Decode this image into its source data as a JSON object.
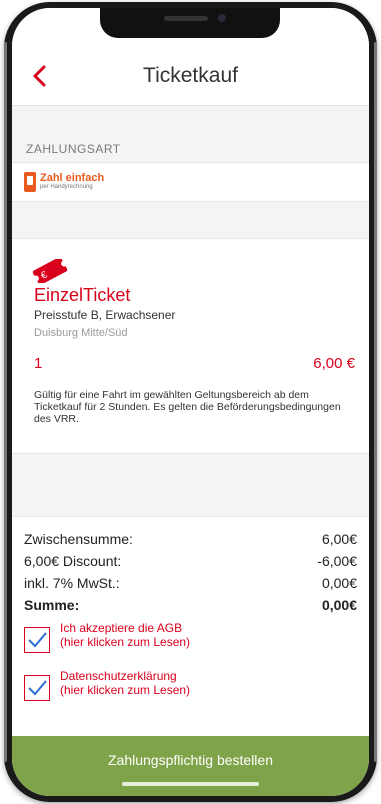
{
  "header": {
    "title": "Ticketkauf"
  },
  "payment": {
    "section_label": "ZAHLUNGSART",
    "provider_name": "Zahl einfach",
    "provider_sub": "per Handyrechnung"
  },
  "ticket": {
    "title": "EinzelTicket",
    "subtitle": "Preisstufe B, Erwachsener",
    "zone": "Duisburg Mitte/Süd",
    "quantity": "1",
    "price": "6,00 €",
    "description": "Gültig für eine Fahrt im gewählten Geltungsbereich ab dem Ticketkauf für 2 Stunden. Es gelten die Beförderungsbedingungen des VRR."
  },
  "summary": {
    "rows": [
      {
        "label": "Zwischensumme:",
        "value": "6,00€"
      },
      {
        "label": "6,00€ Discount:",
        "value": "-6,00€"
      },
      {
        "label": "inkl. 7% MwSt.:",
        "value": "0,00€"
      },
      {
        "label": "Summe:",
        "value": "0,00€"
      }
    ]
  },
  "consents": [
    {
      "line1": "Ich akzeptiere die AGB",
      "line2": "(hier klicken zum Lesen)",
      "checked": true
    },
    {
      "line1": "Datenschutzerklärung",
      "line2": "(hier klicken zum Lesen)",
      "checked": true
    }
  ],
  "order_button": {
    "label": "Zahlungspflichtig bestellen"
  },
  "colors": {
    "accent": "#d9001b",
    "button": "#7fa349",
    "provider": "#e85a1f"
  }
}
